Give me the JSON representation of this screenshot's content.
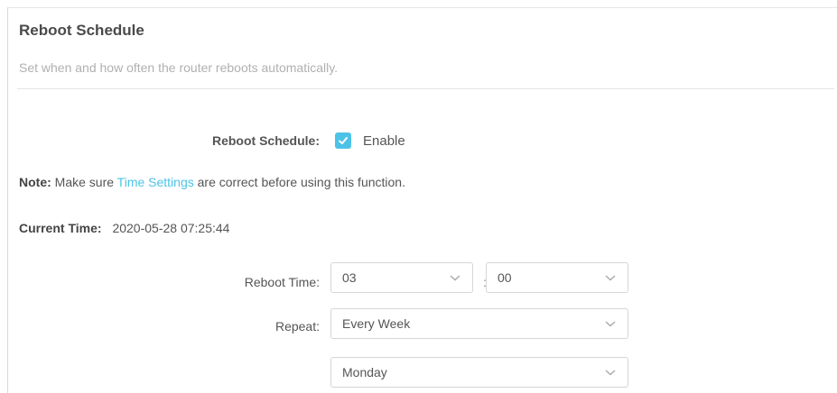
{
  "section": {
    "title": "Reboot Schedule",
    "description": "Set when and how often the router reboots automatically."
  },
  "reboot_schedule": {
    "label": "Reboot Schedule:",
    "enable_label": "Enable",
    "enabled": true
  },
  "note": {
    "prefix": "Note:",
    "text_before": " Make sure ",
    "link": "Time Settings",
    "text_after": " are correct before using this function."
  },
  "current_time": {
    "label": "Current Time:",
    "value": "2020-05-28 07:25:44"
  },
  "reboot_time": {
    "label": "Reboot Time:",
    "hour": "03",
    "separator": ":",
    "minute": "00"
  },
  "repeat": {
    "label": "Repeat:",
    "frequency": "Every Week",
    "day": "Monday"
  },
  "colors": {
    "accent": "#4cc3e6"
  }
}
